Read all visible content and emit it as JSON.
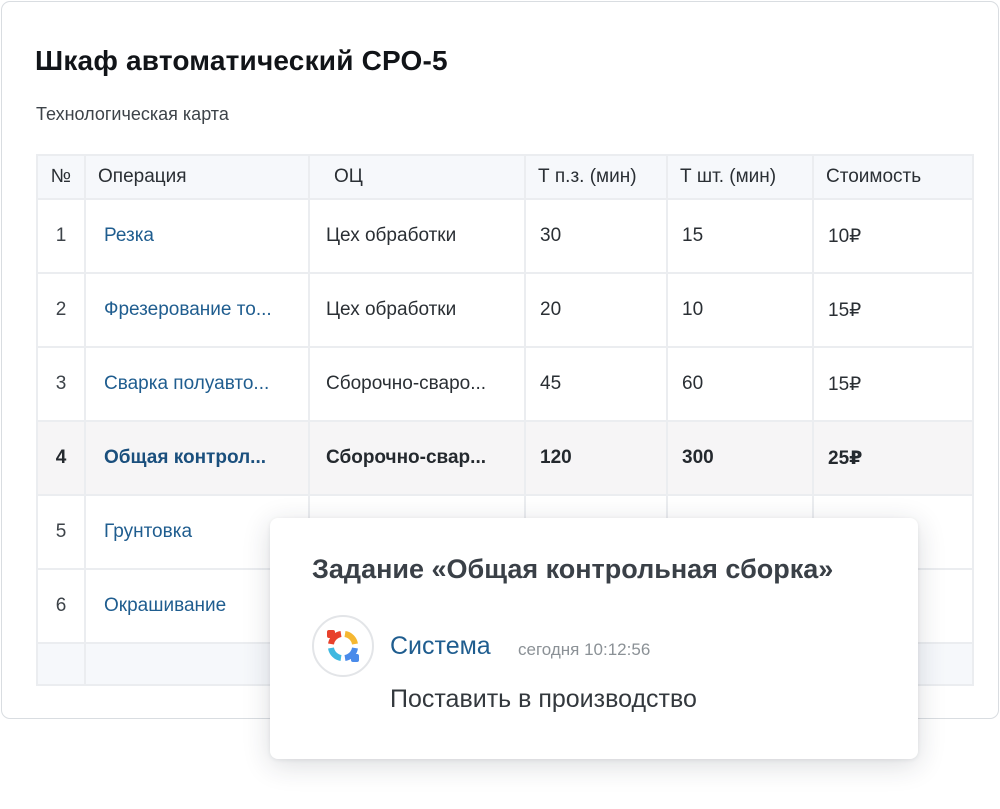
{
  "card": {
    "title": "Шкаф автоматический СРО-5",
    "subtitle": "Технологическая карта"
  },
  "table": {
    "headers": {
      "num": "№",
      "operation": "Операция",
      "oc": "ОЦ",
      "t_pz": "Т п.з. (мин)",
      "t_sht": "Т шт. (мин)",
      "cost": "Стоимость"
    },
    "rows": [
      {
        "num": "1",
        "operation": "Резка",
        "oc": "Цех обработки",
        "t_pz": "30",
        "t_sht": "15",
        "cost": "10₽"
      },
      {
        "num": "2",
        "operation": "Фрезерование то...",
        "oc": "Цех обработки",
        "t_pz": "20",
        "t_sht": "10",
        "cost": "15₽"
      },
      {
        "num": "3",
        "operation": "Сварка полуавто...",
        "oc": "Сборочно-сваро...",
        "t_pz": "45",
        "t_sht": "60",
        "cost": "15₽"
      },
      {
        "num": "4",
        "operation": "Общая контрол...",
        "oc": "Сборочно-свар...",
        "t_pz": "120",
        "t_sht": "300",
        "cost": "25₽"
      },
      {
        "num": "5",
        "operation": "Грунтовка",
        "oc": "",
        "t_pz": "",
        "t_sht": "",
        "cost": ""
      },
      {
        "num": "6",
        "operation": "Окрашивание",
        "oc": "",
        "t_pz": "",
        "t_sht": "",
        "cost": ""
      }
    ]
  },
  "popup": {
    "title": "Задание «Общая контрольная сборка»",
    "sender": "Система",
    "time": "сегодня 10:12:56",
    "message": "Поставить в производство",
    "avatar_icon": "system-logo-icon"
  }
}
